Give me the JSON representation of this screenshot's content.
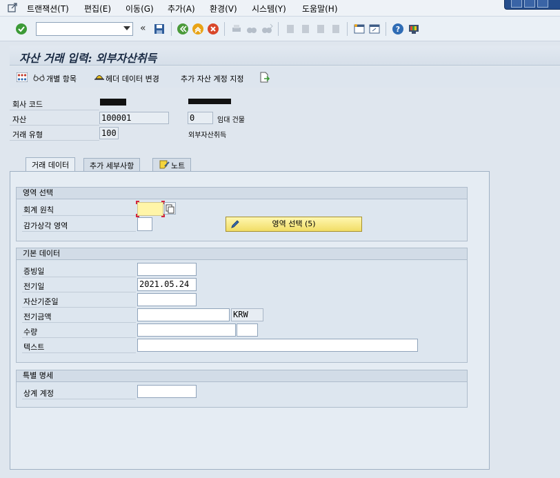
{
  "menu": {
    "items": [
      "트랜잭션(T)",
      "편집(E)",
      "이동(G)",
      "추가(A)",
      "환경(V)",
      "시스템(Y)",
      "도움말(H)"
    ]
  },
  "toolbar": {
    "command_field_value": "",
    "nav_back_glyph": "«",
    "icons": [
      "enter-icon",
      "save-icon",
      "back-icon",
      "exit-icon",
      "cancel-icon",
      "print-icon",
      "find-icon",
      "find-next-icon",
      "first-page-icon",
      "prev-page-icon",
      "next-page-icon",
      "last-page-icon",
      "create-session-icon",
      "shortcut-icon",
      "help-icon",
      "customize-layout-icon"
    ]
  },
  "title": "자산 거래 입력: 외부자산취득",
  "app_toolbar": {
    "multiple_screen_icon": "multiple-screen-icon",
    "individual_item": "개별 항목",
    "header_data": "헤더 데이터 변경",
    "additional_account": "추가 자산 계정 지정"
  },
  "header": {
    "company_code_label": "회사 코드",
    "asset_label": "자산",
    "asset_value": "100001",
    "sub_number_value": "0",
    "sub_number_suffix": "임대 건물",
    "transaction_type_label": "거래 유형",
    "transaction_type_value": "100",
    "transaction_type_desc": "외부자산취득"
  },
  "tabs": [
    {
      "label": "거래 데이터",
      "active": true
    },
    {
      "label": "추가 세부사항",
      "active": false
    },
    {
      "label": "노트",
      "active": false
    }
  ],
  "area_selection": {
    "title": "영역 선택",
    "accounting_principle_label": "회계 원칙",
    "accounting_principle_value": "",
    "depreciation_area_label": "감가상각 영역",
    "depreciation_area_value": "",
    "button_label": "영역 선택 (5)"
  },
  "basic_data": {
    "title": "기본 데이터",
    "document_date_label": "증빙일",
    "document_date_value": "",
    "posting_date_label": "전기일",
    "posting_date_value": "2021.05.24",
    "asset_value_date_label": "자산기준일",
    "asset_value_date_value": "",
    "amount_label": "전기금액",
    "amount_value": "",
    "currency_value": "KRW",
    "quantity_label": "수량",
    "quantity_value": "",
    "unit_value": "",
    "text_label": "텍스트",
    "text_value": ""
  },
  "special": {
    "title": "특별 명세",
    "offset_account_label": "상계 계정",
    "offset_account_value": ""
  },
  "colors": {
    "accent_yellow": "#f1dd66",
    "required_field": "#fff5a8",
    "title_blue": "#1a2b44",
    "background": "#dfe6ee"
  }
}
